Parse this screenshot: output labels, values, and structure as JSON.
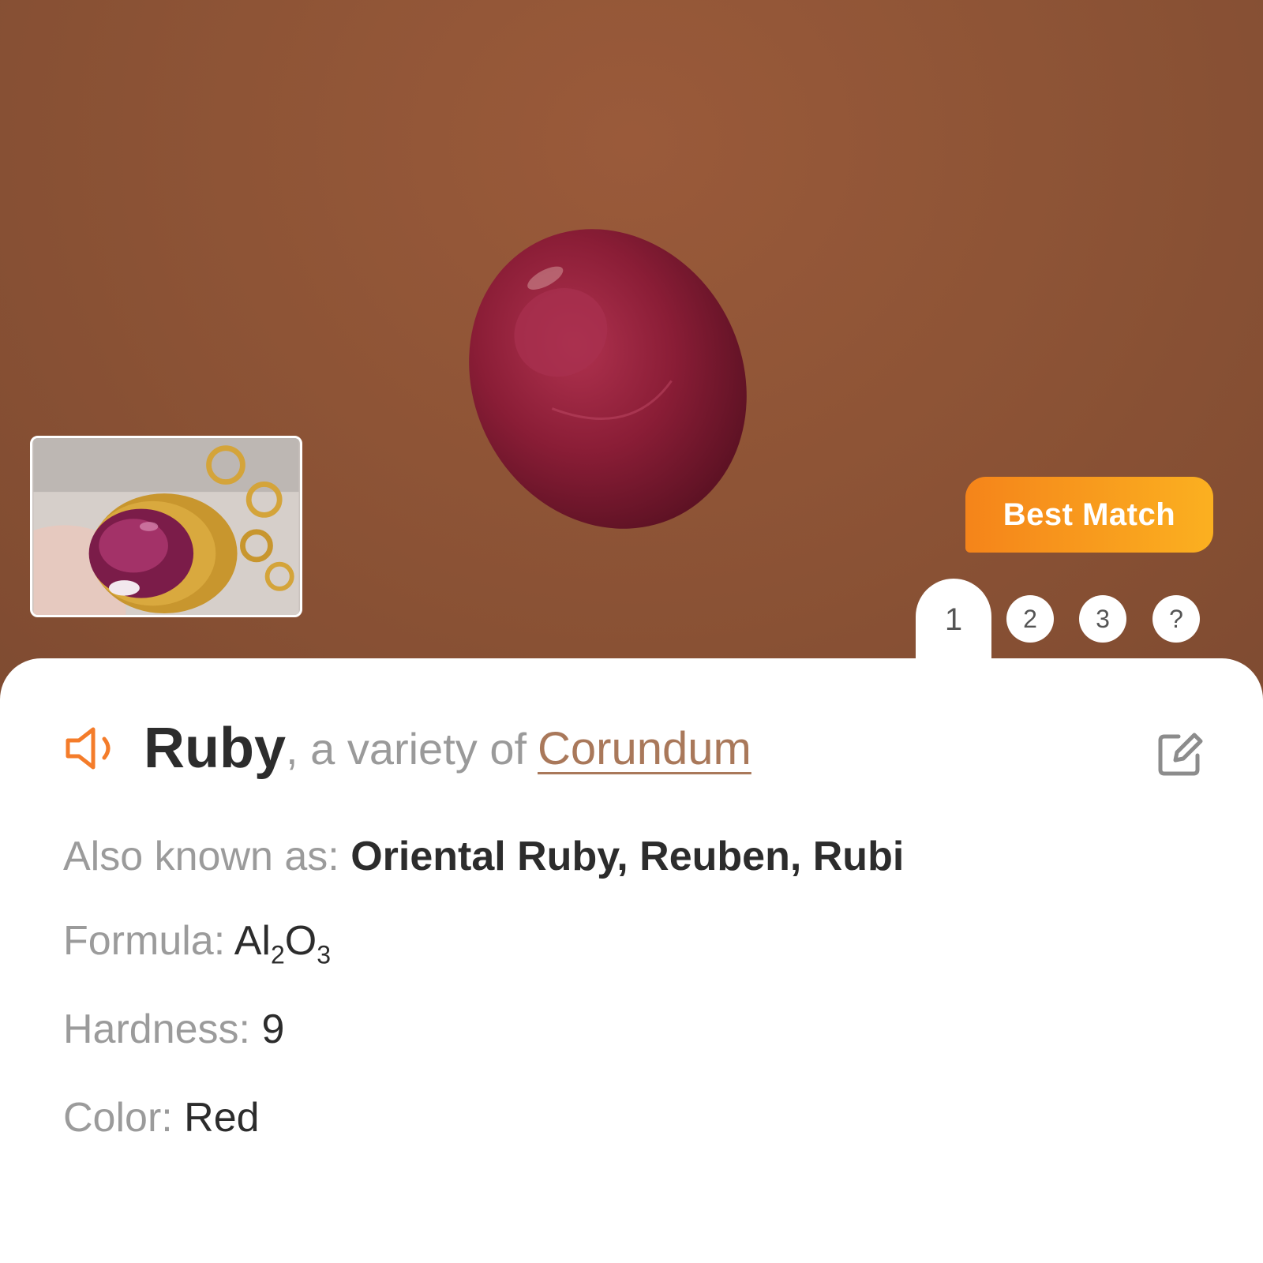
{
  "header": {
    "badge_label": "Best Match",
    "tabs": [
      "1",
      "2",
      "3",
      "?"
    ],
    "active_tab": "1",
    "thumbnail_icon": "jewelry-photo-thumbnail",
    "photo_icon": "ruby-stone-photo"
  },
  "result": {
    "name": "Ruby",
    "variety_text": ", a variety of",
    "parent": "Corundum",
    "speaker_icon": "speaker-icon",
    "edit_icon": "edit-icon",
    "also_known_label": "Also known as:",
    "also_known_value": "Oriental Ruby, Reuben, Rubi",
    "formula_label": "Formula:",
    "formula": {
      "el1": "Al",
      "n1": "2",
      "el2": "O",
      "n2": "3"
    },
    "hardness_label": "Hardness:",
    "hardness_value": "9",
    "color_label": "Color:",
    "color_value": "Red"
  },
  "colors": {
    "accent": "#f5841a",
    "accent_light": "#fbb020",
    "link": "#a9785a",
    "hero_bg": "#8e5436"
  }
}
